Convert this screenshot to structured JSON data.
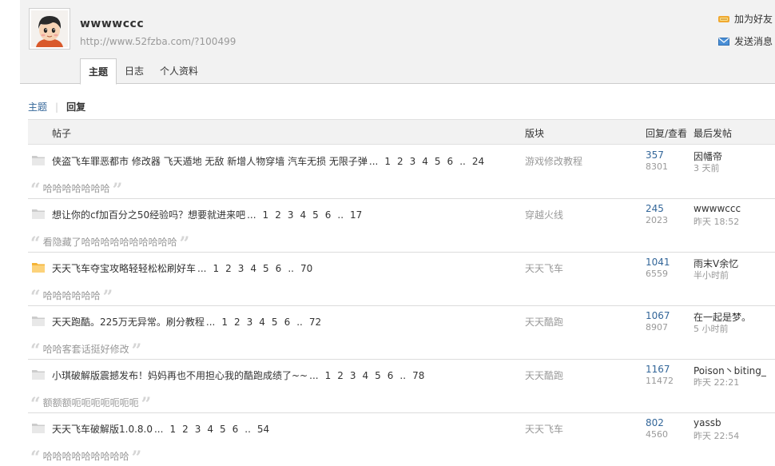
{
  "user": {
    "name": "wwwwccc",
    "url": "http://www.52fzba.com/?100499"
  },
  "actions": {
    "add_friend": "加为好友",
    "send_message": "发送消息"
  },
  "tabs": [
    {
      "label": "主题",
      "active": true
    },
    {
      "label": "日志",
      "active": false
    },
    {
      "label": "个人资料",
      "active": false
    }
  ],
  "subnav": {
    "topics": "主题",
    "separator": "|",
    "replies": "回复"
  },
  "table": {
    "headers": {
      "post": "帖子",
      "forum": "版块",
      "replies_views": "回复/查看",
      "last_post": "最后发帖"
    },
    "rows": [
      {
        "icon": "folder-gray",
        "title": "侠盗飞车罪恶都市 修改器 飞天遁地 无敌 新增人物穿墙 汽车无损 无限子弹",
        "dots": "...",
        "pages": [
          "1",
          "2",
          "3",
          "4",
          "5",
          "6",
          "..",
          "24"
        ],
        "forum": "游戏修改教程",
        "replies": "357",
        "views": "8301",
        "last_user": "因幡帝",
        "last_time": "3 天前",
        "quote": "哈哈哈哈哈哈哈"
      },
      {
        "icon": "folder-gray",
        "title": "想让你的cf加百分之50经验吗？想要就进来吧",
        "dots": "...",
        "pages": [
          "1",
          "2",
          "3",
          "4",
          "5",
          "6",
          "..",
          "17"
        ],
        "forum": "穿越火线",
        "replies": "245",
        "views": "2023",
        "last_user": "wwwwccc",
        "last_time": "昨天 18:52",
        "quote": "看隐藏了哈哈哈哈哈哈哈哈哈哈"
      },
      {
        "icon": "folder-hot",
        "title": "天天飞车夺宝攻略轻轻松松刷好车",
        "dots": "...",
        "pages": [
          "1",
          "2",
          "3",
          "4",
          "5",
          "6",
          "..",
          "70"
        ],
        "forum": "天天飞车",
        "replies": "1041",
        "views": "6559",
        "last_user": "雨末V余忆",
        "last_time": "半小时前",
        "quote": "哈哈哈哈哈哈"
      },
      {
        "icon": "folder-gray",
        "title": "天天跑酷。225万无异常。刷分教程",
        "dots": "...",
        "pages": [
          "1",
          "2",
          "3",
          "4",
          "5",
          "6",
          "..",
          "72"
        ],
        "forum": "天天酷跑",
        "replies": "1067",
        "views": "8907",
        "last_user": "在一起是梦。",
        "last_time": "5 小时前",
        "quote": "哈哈客套话挺好修改"
      },
      {
        "icon": "folder-gray",
        "title": "小琪破解版震撼发布！妈妈再也不用担心我的酷跑成绩了~~",
        "dots": "...",
        "pages": [
          "1",
          "2",
          "3",
          "4",
          "5",
          "6",
          "..",
          "78"
        ],
        "forum": "天天酷跑",
        "replies": "1167",
        "views": "11472",
        "last_user": "Poison丶biting_",
        "last_time": "昨天 22:21",
        "quote": "额额额呃呃呃呃呃呃呃"
      },
      {
        "icon": "folder-gray",
        "title": "天天飞车破解版1.0.8.0",
        "dots": "...",
        "pages": [
          "1",
          "2",
          "3",
          "4",
          "5",
          "6",
          "..",
          "54"
        ],
        "forum": "天天飞车",
        "replies": "802",
        "views": "4560",
        "last_user": "yassb",
        "last_time": "昨天 22:54",
        "quote": "哈哈哈哈哈哈哈哈哈"
      }
    ]
  },
  "colors": {
    "link": "#336699",
    "muted": "#999999",
    "header_bg": "#f2f2f2",
    "hot_folder": "#f5b335",
    "gray_folder": "#cccccc"
  }
}
